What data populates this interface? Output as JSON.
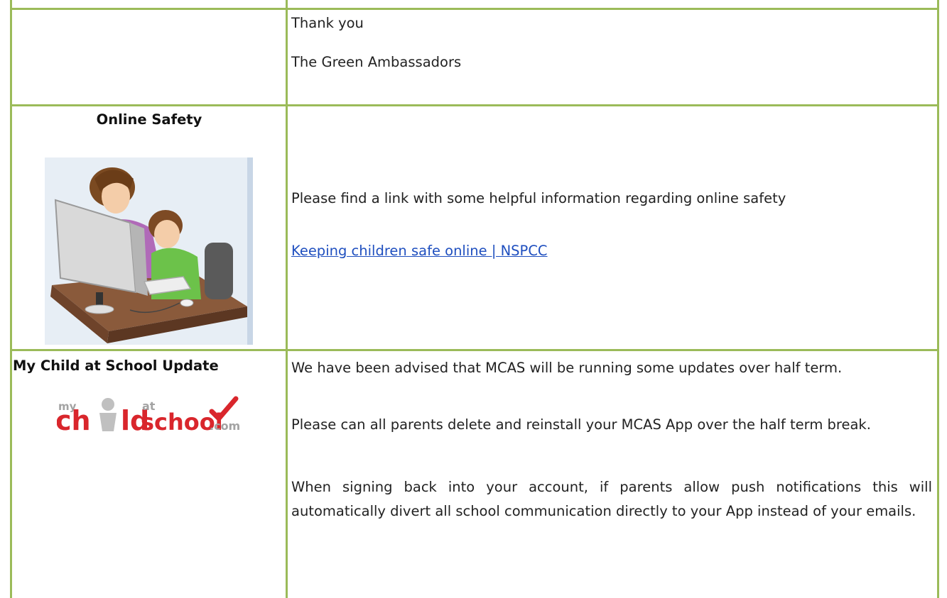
{
  "rows": {
    "closing": {
      "lines": [
        "Thank you",
        "The Green Ambassadors"
      ]
    },
    "online_safety": {
      "heading": "Online Safety",
      "image_alt": "parent and child at computer illustration",
      "text": "Please find a link with some helpful information regarding online safety",
      "link_text": "Keeping children safe online | NSPCC"
    },
    "mcas": {
      "heading": "My Child at School Update",
      "logo": {
        "prefix": "my",
        "ch": "ch",
        "at": "at",
        "ld": "ld",
        "school": "school",
        "com": ".com"
      },
      "paragraphs": [
        "We have been advised that MCAS will be running some updates over half term.",
        "Please can all parents delete and reinstall your MCAS App over the half term break.",
        "When signing back into your account, if parents allow push notifications this will automatically divert all school communication directly to your App instead of your emails."
      ]
    }
  },
  "colors": {
    "border": "#9bbb59",
    "link": "#1f4fbf",
    "logo_red": "#d9262c",
    "logo_grey": "#a3a3a3"
  }
}
